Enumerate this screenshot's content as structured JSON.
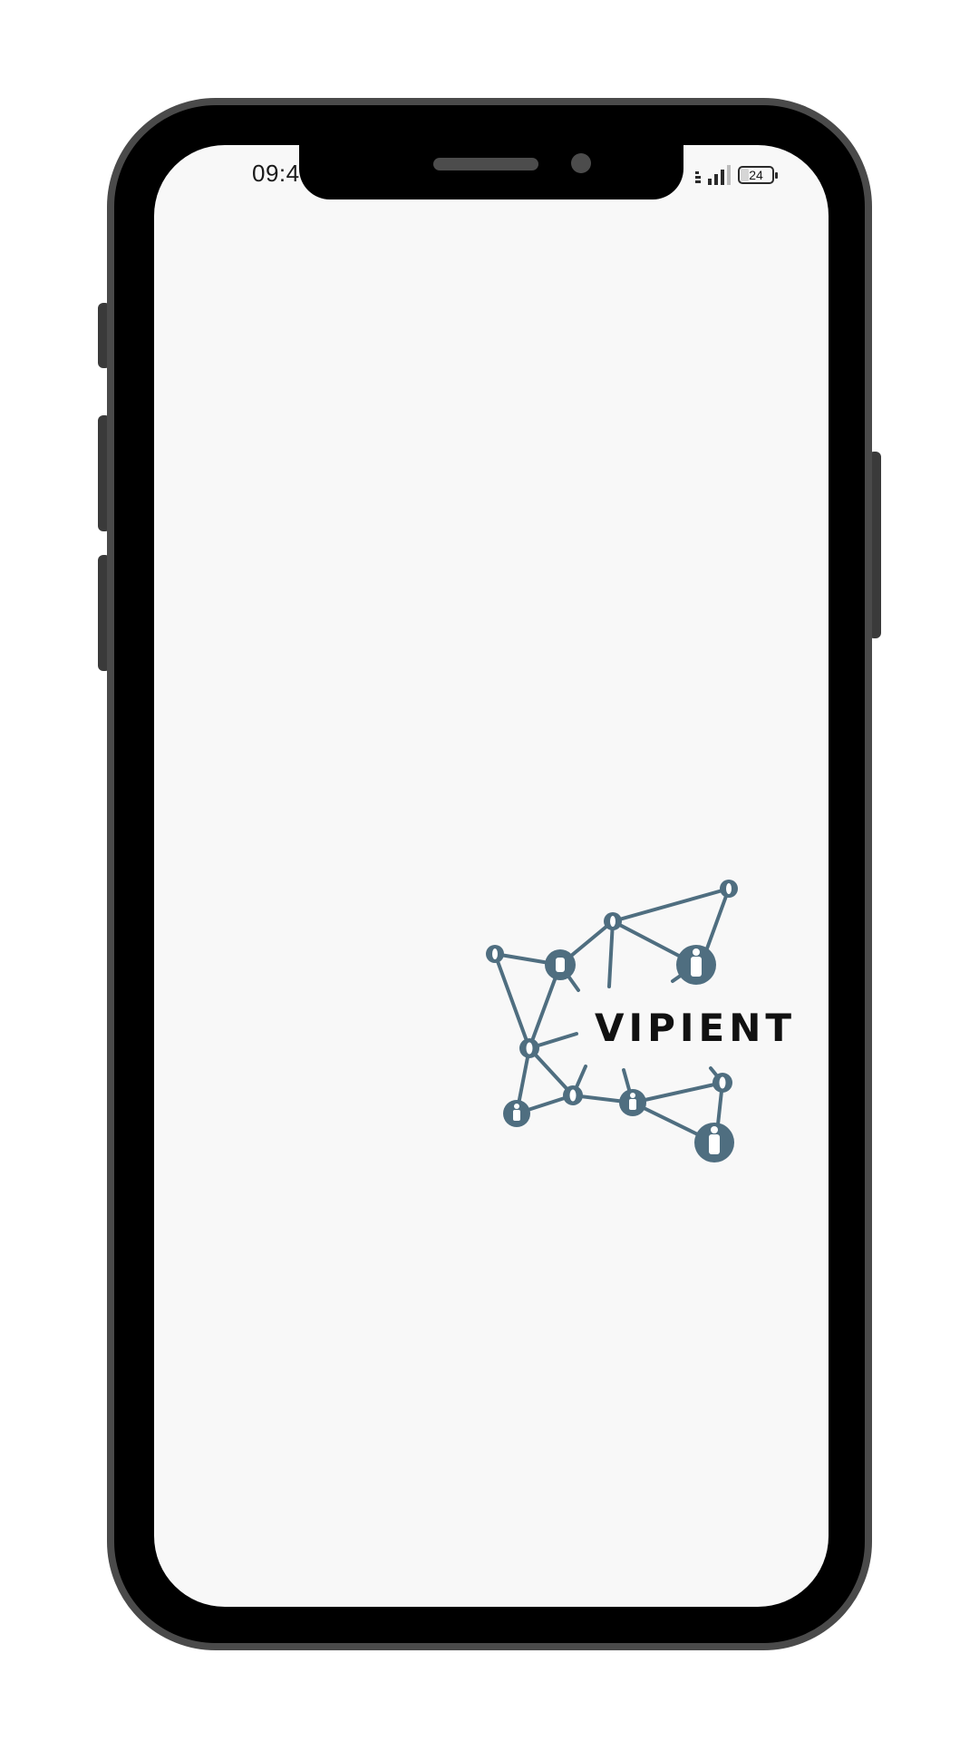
{
  "status_bar": {
    "time": "09:4",
    "battery_level": "24"
  },
  "app": {
    "brand_name": "VIPIENT"
  },
  "colors": {
    "logo_node": "#4f6e80",
    "screen_background": "#f8f8f8",
    "wordmark": "#111111"
  },
  "icons": {
    "logo": "people-network-icon",
    "signal": "cellular-signal-icon",
    "battery": "battery-icon"
  }
}
